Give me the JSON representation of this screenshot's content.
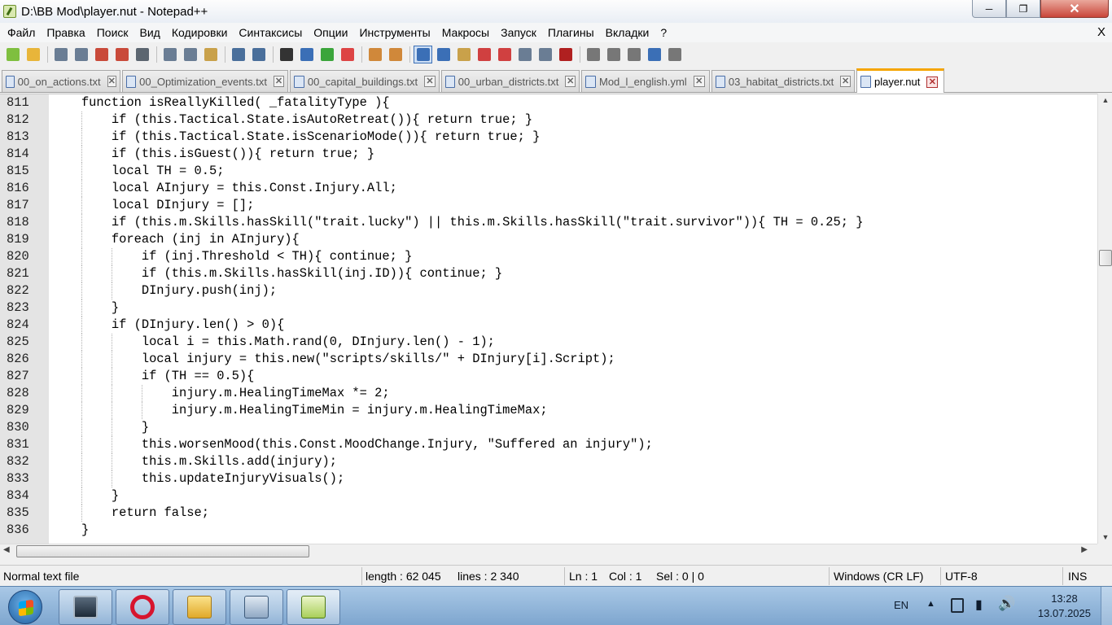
{
  "window": {
    "title": "D:\\BB Mod\\player.nut - Notepad++"
  },
  "menu": [
    "Файл",
    "Правка",
    "Поиск",
    "Вид",
    "Кодировки",
    "Синтаксисы",
    "Опции",
    "Инструменты",
    "Макросы",
    "Запуск",
    "Плагины",
    "Вкладки",
    "?"
  ],
  "menu_close": "X",
  "toolbar_icons": [
    "new-file-icon",
    "open-file-icon",
    "save-icon",
    "save-all-icon",
    "close-icon",
    "close-all-icon",
    "print-icon",
    "cut-icon",
    "copy-icon",
    "paste-icon",
    "undo-icon",
    "redo-icon",
    "find-icon",
    "replace-icon",
    "zoom-in-icon",
    "zoom-out-icon",
    "sync-vertical-icon",
    "sync-horizontal-icon",
    "word-wrap-icon",
    "show-all-chars-icon",
    "indent-guide-icon",
    "udl-icon",
    "doc-map-icon",
    "function-list-icon",
    "folder-workspace-icon",
    "monitoring-icon",
    "record-macro-icon",
    "stop-record-icon",
    "play-macro-icon",
    "run-multiple-icon",
    "save-macro-icon"
  ],
  "tabs": [
    {
      "label": "00_on_actions.txt",
      "active": false
    },
    {
      "label": "00_Optimization_events.txt",
      "active": false
    },
    {
      "label": "00_capital_buildings.txt",
      "active": false
    },
    {
      "label": "00_urban_districts.txt",
      "active": false
    },
    {
      "label": "Mod_l_english.yml",
      "active": false
    },
    {
      "label": "03_habitat_districts.txt",
      "active": false
    },
    {
      "label": "player.nut",
      "active": true
    }
  ],
  "editor": {
    "lines": [
      {
        "n": "811",
        "text": "    function isReallyKilled( _fatalityType ){"
      },
      {
        "n": "812",
        "text": "        if (this.Tactical.State.isAutoRetreat()){ return true; }"
      },
      {
        "n": "813",
        "text": "        if (this.Tactical.State.isScenarioMode()){ return true; }"
      },
      {
        "n": "814",
        "text": "        if (this.isGuest()){ return true; }"
      },
      {
        "n": "815",
        "text": "        local TH = 0.5;"
      },
      {
        "n": "816",
        "text": "        local AInjury = this.Const.Injury.All;"
      },
      {
        "n": "817",
        "text": "        local DInjury = [];"
      },
      {
        "n": "818",
        "text": "        if (this.m.Skills.hasSkill(\"trait.lucky\") || this.m.Skills.hasSkill(\"trait.survivor\")){ TH = 0.25; }"
      },
      {
        "n": "819",
        "text": "        foreach (inj in AInjury){"
      },
      {
        "n": "820",
        "text": "            if (inj.Threshold < TH){ continue; }"
      },
      {
        "n": "821",
        "text": "            if (this.m.Skills.hasSkill(inj.ID)){ continue; }"
      },
      {
        "n": "822",
        "text": "            DInjury.push(inj);"
      },
      {
        "n": "823",
        "text": "        }"
      },
      {
        "n": "824",
        "text": "        if (DInjury.len() > 0){"
      },
      {
        "n": "825",
        "text": "            local i = this.Math.rand(0, DInjury.len() - 1);"
      },
      {
        "n": "826",
        "text": "            local injury = this.new(\"scripts/skills/\" + DInjury[i].Script);"
      },
      {
        "n": "827",
        "text": "            if (TH == 0.5){"
      },
      {
        "n": "828",
        "text": "                injury.m.HealingTimeMax *= 2;"
      },
      {
        "n": "829",
        "text": "                injury.m.HealingTimeMin = injury.m.HealingTimeMax;"
      },
      {
        "n": "830",
        "text": "            }"
      },
      {
        "n": "831",
        "text": "            this.worsenMood(this.Const.MoodChange.Injury, \"Suffered an injury\");"
      },
      {
        "n": "832",
        "text": "            this.m.Skills.add(injury);"
      },
      {
        "n": "833",
        "text": "            this.updateInjuryVisuals();"
      },
      {
        "n": "834",
        "text": "        }"
      },
      {
        "n": "835",
        "text": "        return false;"
      },
      {
        "n": "836",
        "text": "    }"
      }
    ]
  },
  "status": {
    "file_type": "Normal text file",
    "length": "length : 62 045",
    "lines": "lines : 2 340",
    "ln": "Ln : 1",
    "col": "Col : 1",
    "sel": "Sel : 0 | 0",
    "eol": "Windows (CR LF)",
    "encoding": "UTF-8",
    "mode": "INS"
  },
  "taskbar": {
    "lang": "EN",
    "time": "13:28",
    "date": "13.07.2025"
  }
}
